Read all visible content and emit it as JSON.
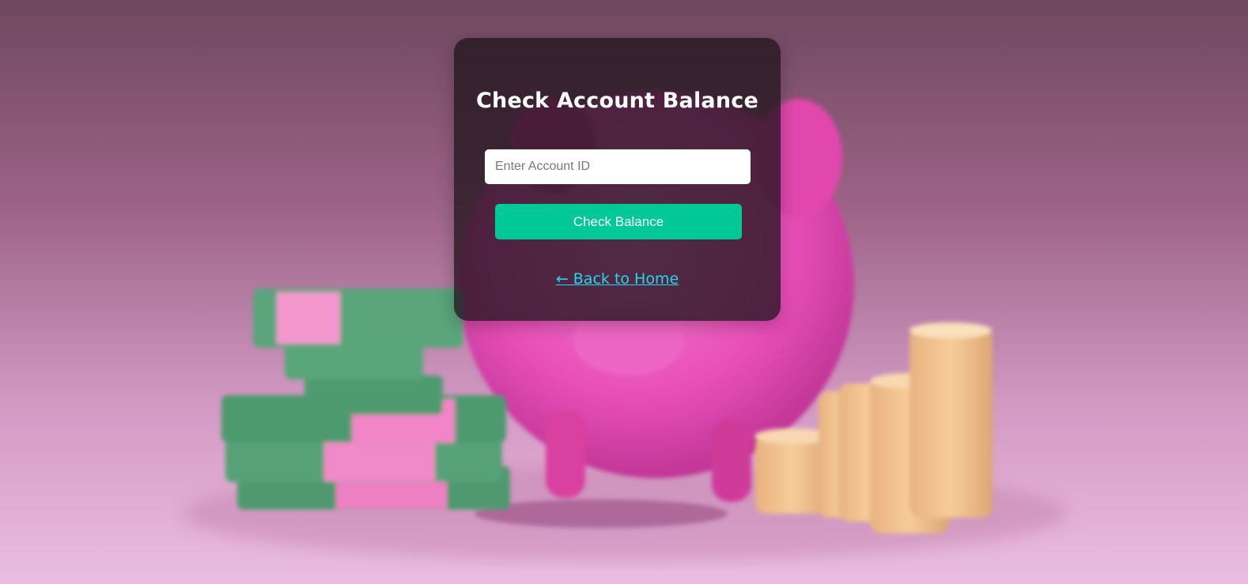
{
  "page": {
    "title": "Check Account Balance"
  },
  "form": {
    "account_input": {
      "placeholder": "Enter Account ID",
      "value": ""
    },
    "submit_label": "Check Balance"
  },
  "nav": {
    "back_link_label": "← Back to Home"
  },
  "colors": {
    "button": "#00c897",
    "link": "#22d8ec",
    "card": "rgba(34,20,30,0.78)"
  }
}
